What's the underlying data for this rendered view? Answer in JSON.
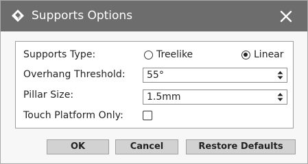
{
  "window": {
    "title": "Supports Options",
    "app_icon": "diamond-cube-icon",
    "close_icon": "close-x-icon"
  },
  "supports_type": {
    "label": "Supports Type:",
    "options": [
      {
        "label": "Treelike",
        "selected": false
      },
      {
        "label": "Linear",
        "selected": true
      }
    ]
  },
  "overhang_threshold": {
    "label": "Overhang Threshold:",
    "value": "55°"
  },
  "pillar_size": {
    "label": "Pillar Size:",
    "value": "1.5mm"
  },
  "touch_platform_only": {
    "label": "Touch Platform Only:",
    "checked": false
  },
  "buttons": {
    "ok": "OK",
    "cancel": "Cancel",
    "restore_defaults": "Restore Defaults"
  },
  "colors": {
    "titlebar": "#6d6d6d",
    "button_face": "#d2d2d2",
    "dialog_bg": "#f7f7f7"
  }
}
